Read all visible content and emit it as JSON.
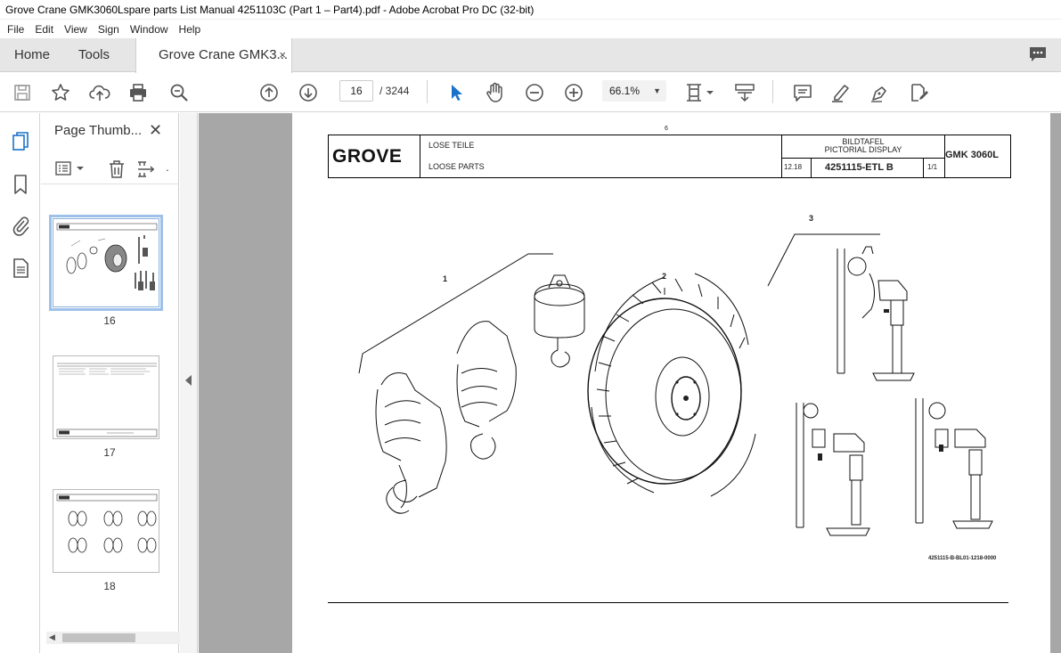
{
  "window": {
    "title": "Grove Crane GMK3060Lspare parts List Manual 4251103C (Part 1 – Part4).pdf - Adobe Acrobat Pro DC (32-bit)"
  },
  "menu": [
    "File",
    "Edit",
    "View",
    "Sign",
    "Window",
    "Help"
  ],
  "tabs": {
    "home": "Home",
    "tools": "Tools",
    "document": "Grove Crane GMK3...",
    "close": "×"
  },
  "toolbar": {
    "current_page": "16",
    "page_count": "/  3244",
    "zoom": "66.1%",
    "icons": [
      "save-icon",
      "bookmark-star-icon",
      "upload-icon",
      "print-icon",
      "search-zoom-icon",
      "page-up-icon",
      "page-down-icon",
      "select-cursor-icon",
      "hand-icon",
      "zoom-out-icon",
      "zoom-in-icon",
      "page-fit-icon",
      "scroll-mode-icon",
      "comment-icon",
      "highlight-icon",
      "sign-icon",
      "edit-pdf-icon"
    ]
  },
  "sidebar": {
    "title": "Page Thumb...",
    "close": "✕",
    "thumbnails": [
      {
        "page": "16",
        "selected": true
      },
      {
        "page": "17",
        "selected": false
      },
      {
        "page": "18",
        "selected": false
      }
    ]
  },
  "document_page": {
    "page_marker": "6",
    "logo": "GROVE",
    "label_de": "LOSE TEILE",
    "label_en": "LOOSE PARTS",
    "display_de": "BILDTAFEL",
    "display_en": "PICTORIAL DISPLAY",
    "date": "12.18",
    "part_number": "4251115-ETL B",
    "sheet": "1/1",
    "model": "GMK 3060L",
    "callouts": [
      "1",
      "2",
      "3"
    ],
    "drawing_number": "4251115-B-BL01-1218-0000"
  }
}
